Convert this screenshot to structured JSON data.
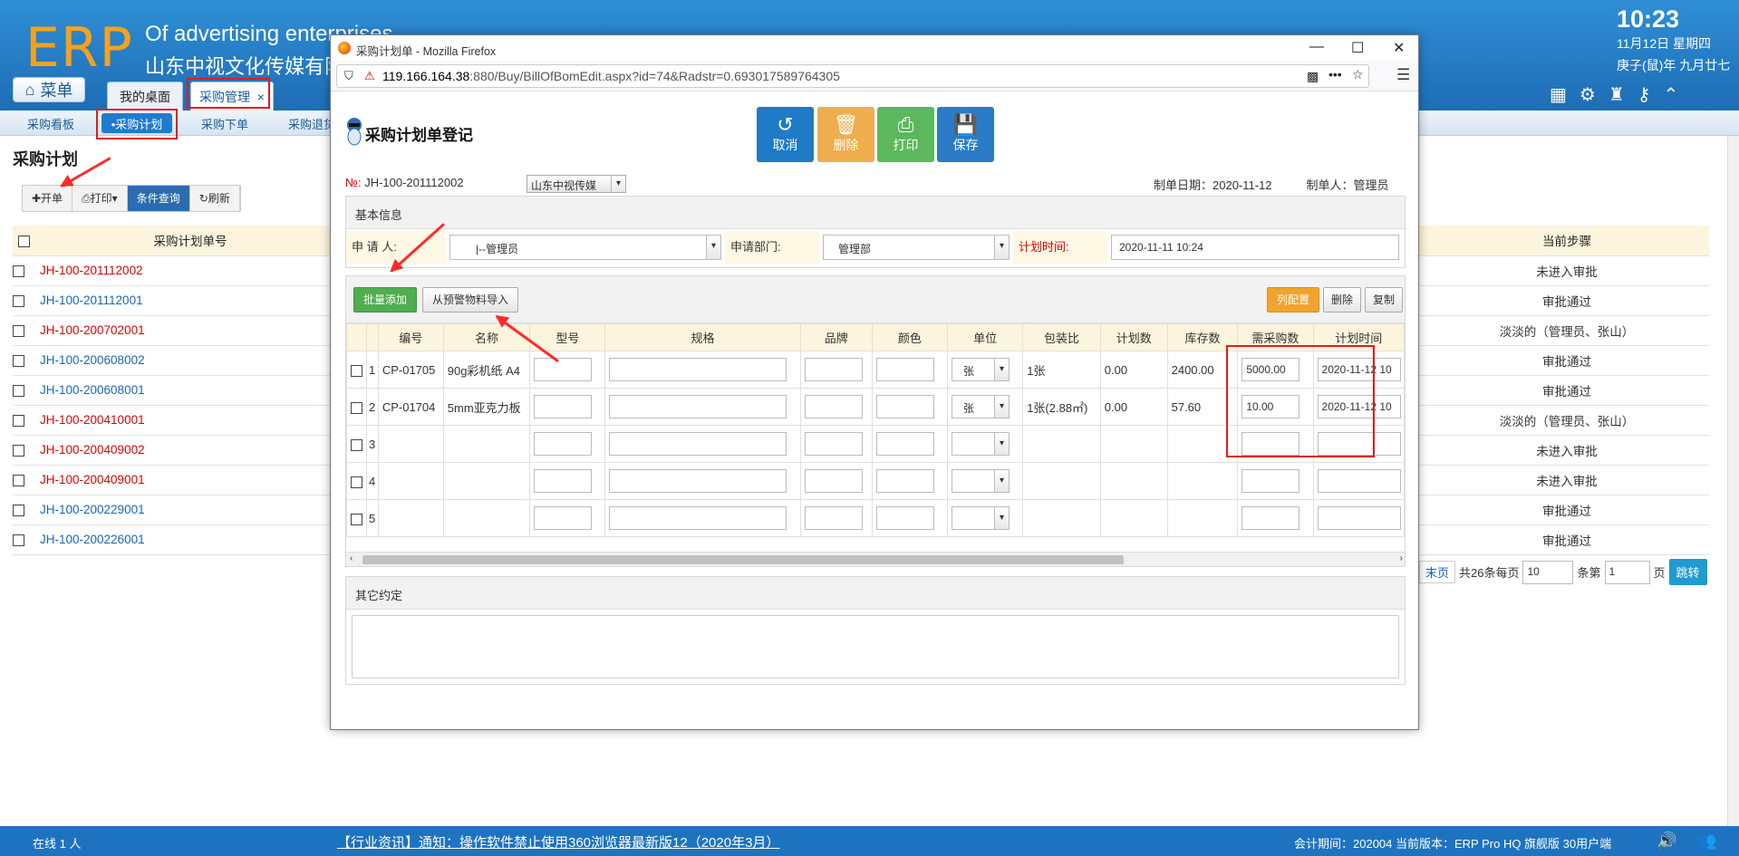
{
  "header": {
    "logo": "ERP",
    "company_en": "Of advertising enterprises",
    "company_cn": "山东中视文化传媒有限公",
    "time": "10:23",
    "date": "11月12日 星期四",
    "lunar": "庚子(鼠)年 九月廿七",
    "menu_label": "菜单",
    "tabs": [
      {
        "label": "我的桌面"
      },
      {
        "label": "采购管理",
        "close": "×"
      }
    ]
  },
  "subnav": {
    "items": [
      "采购看板",
      "•采购计划",
      "采购下单",
      "采购退货"
    ]
  },
  "list": {
    "title": "采购计划",
    "toolbar": [
      "✚开单",
      "打印▾",
      "条件查询",
      "刷新"
    ],
    "col_code": "采购计划单号",
    "col_step": "当前步骤",
    "rows": [
      {
        "code": "JH-100-201112002",
        "step": "未进入审批",
        "color": "red"
      },
      {
        "code": "JH-100-201112001",
        "step": "审批通过",
        "color": "blue"
      },
      {
        "code": "JH-100-200702001",
        "step": "淡淡的（管理员、张山）",
        "color": "red"
      },
      {
        "code": "JH-100-200608002",
        "step": "审批通过",
        "color": "blue"
      },
      {
        "code": "JH-100-200608001",
        "step": "审批通过",
        "color": "blue"
      },
      {
        "code": "JH-100-200410001",
        "step": "淡淡的（管理员、张山）",
        "color": "red"
      },
      {
        "code": "JH-100-200409002",
        "step": "未进入审批",
        "color": "red"
      },
      {
        "code": "JH-100-200409001",
        "step": "未进入审批",
        "color": "red"
      },
      {
        "code": "JH-100-200229001",
        "step": "审批通过",
        "color": "blue"
      },
      {
        "code": "JH-100-200226001",
        "step": "审批通过",
        "color": "blue"
      }
    ],
    "pager": {
      "last": "末页",
      "total": "共26条每页",
      "per": "10",
      "per_unit": "条第",
      "page": "1",
      "page_unit": "页",
      "go": "跳转"
    }
  },
  "modal": {
    "window_title": "采购计划单 - Mozilla Firefox",
    "url_host": "119.166.164.38",
    "url_path": ":880/Buy/BillOfBomEdit.aspx?id=74&Radstr=0.693017589764305",
    "title": "采购计划单登记",
    "buttons": {
      "cancel": "取消",
      "delete": "删除",
      "print": "打印",
      "save": "保存"
    },
    "no_label": "№:",
    "no_value": "JH-100-201112002",
    "company": "山东中视传媒",
    "made_date": "制单日期：2020-11-12",
    "maker": "制单人：管理员",
    "basic_title": "基本信息",
    "applicant_label": "申 请 人:",
    "applicant_value": "|--管理员",
    "dept_label": "申请部门:",
    "dept_value": "管理部",
    "time_label": "计划时间:",
    "time_value": "2020-11-11 10:24",
    "grid_buttons": {
      "batch": "批量添加",
      "import": "从预警物料导入",
      "config": "列配置",
      "del": "删除",
      "copy": "复制"
    },
    "columns": [
      "编号",
      "名称",
      "型号",
      "规格",
      "品牌",
      "颜色",
      "单位",
      "包装比",
      "计划数",
      "库存数",
      "需采购数",
      "计划时间"
    ],
    "rows": [
      {
        "idx": "1",
        "code": "CP-01705",
        "name": "90g彩机纸 A4",
        "unit": "张",
        "pack": "1张",
        "plan": "0.00",
        "stock": "2400.00",
        "need": "5000.00",
        "ptime": "2020-11-12 10"
      },
      {
        "idx": "2",
        "code": "CP-01704",
        "name": "5mm亚克力板",
        "unit": "张",
        "pack": "1张(2.88㎡)",
        "plan": "0.00",
        "stock": "57.60",
        "need": "10.00",
        "ptime": "2020-11-12 10"
      },
      {
        "idx": "3",
        "code": "",
        "name": "",
        "unit": "",
        "pack": "",
        "plan": "",
        "stock": "",
        "need": "",
        "ptime": ""
      },
      {
        "idx": "4",
        "code": "",
        "name": "",
        "unit": "",
        "pack": "",
        "plan": "",
        "stock": "",
        "need": "",
        "ptime": ""
      },
      {
        "idx": "5",
        "code": "",
        "name": "",
        "unit": "",
        "pack": "",
        "plan": "",
        "stock": "",
        "need": "",
        "ptime": ""
      }
    ],
    "other_title": "其它约定"
  },
  "footer": {
    "online": "在线  1  人",
    "news": "【行业资讯】通知：操作软件禁止使用360浏览器最新版12（2020年3月）",
    "info": "会计期间：202004 当前版本：ERP Pro HQ 旗舰版 30用户端"
  },
  "colors": {
    "header": "#1d6db5",
    "accent_orange": "#f6a11d",
    "cancel_btn": "#1f7bc6",
    "delete_btn": "#f0ad4e",
    "print_btn": "#5cb85c",
    "save_btn": "#2a7cc7",
    "highlight": "#e21b1b"
  }
}
